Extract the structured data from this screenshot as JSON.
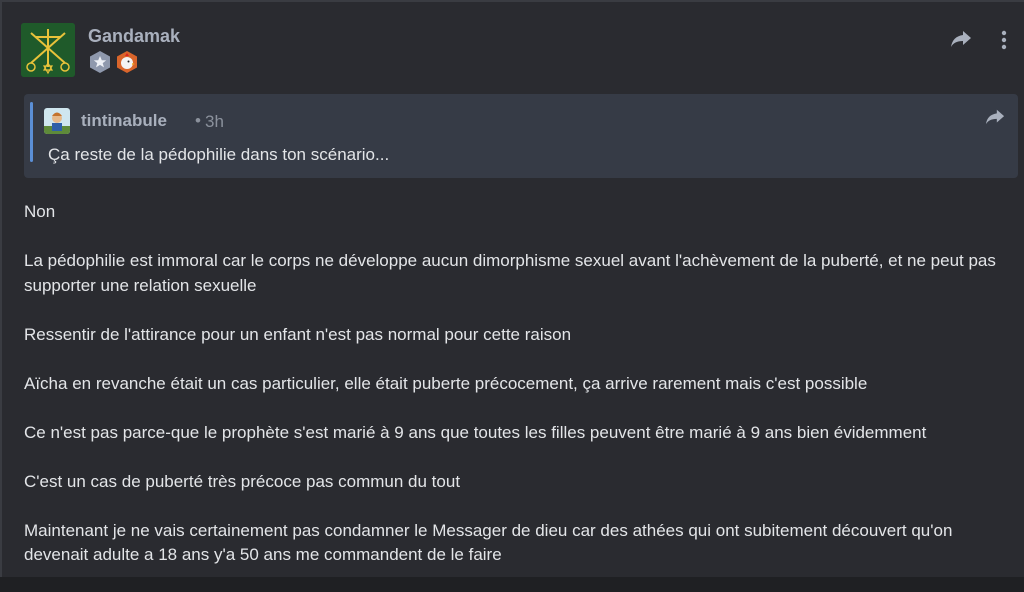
{
  "post": {
    "author": "Gandamak",
    "badges": [
      "silver-star-badge",
      "chicken-badge"
    ],
    "actions": {
      "share_icon": "share-arrow-icon",
      "more_icon": "more-vertical-icon"
    }
  },
  "quote": {
    "author": "tintinabule",
    "separator": "•",
    "time": "3h",
    "text": "Ça reste de la pédophilie dans ton scénario...",
    "accent": "#5b8fd6"
  },
  "body": {
    "paragraphs": [
      "Non",
      "La pédophilie est immoral car le corps ne développe aucun dimorphisme sexuel avant l'achèvement de la puberté, et ne peut pas supporter une relation sexuelle",
      "Ressentir de l'attirance pour un enfant n'est pas normal pour cette raison",
      "Aïcha en revanche était un cas particulier, elle était puberte précocement, ça arrive rarement mais c'est possible",
      "Ce n'est pas parce-que le prophète s'est marié à 9 ans que toutes les filles peuvent être marié à 9 ans bien évidemment",
      "C'est un cas de puberté très précoce pas commun du tout",
      "Maintenant je ne vais certainement pas condamner le Messager de dieu car des athées qui ont subitement découvert qu'on devenait adulte a 18 ans y'a 50 ans me commandent de le faire"
    ]
  }
}
